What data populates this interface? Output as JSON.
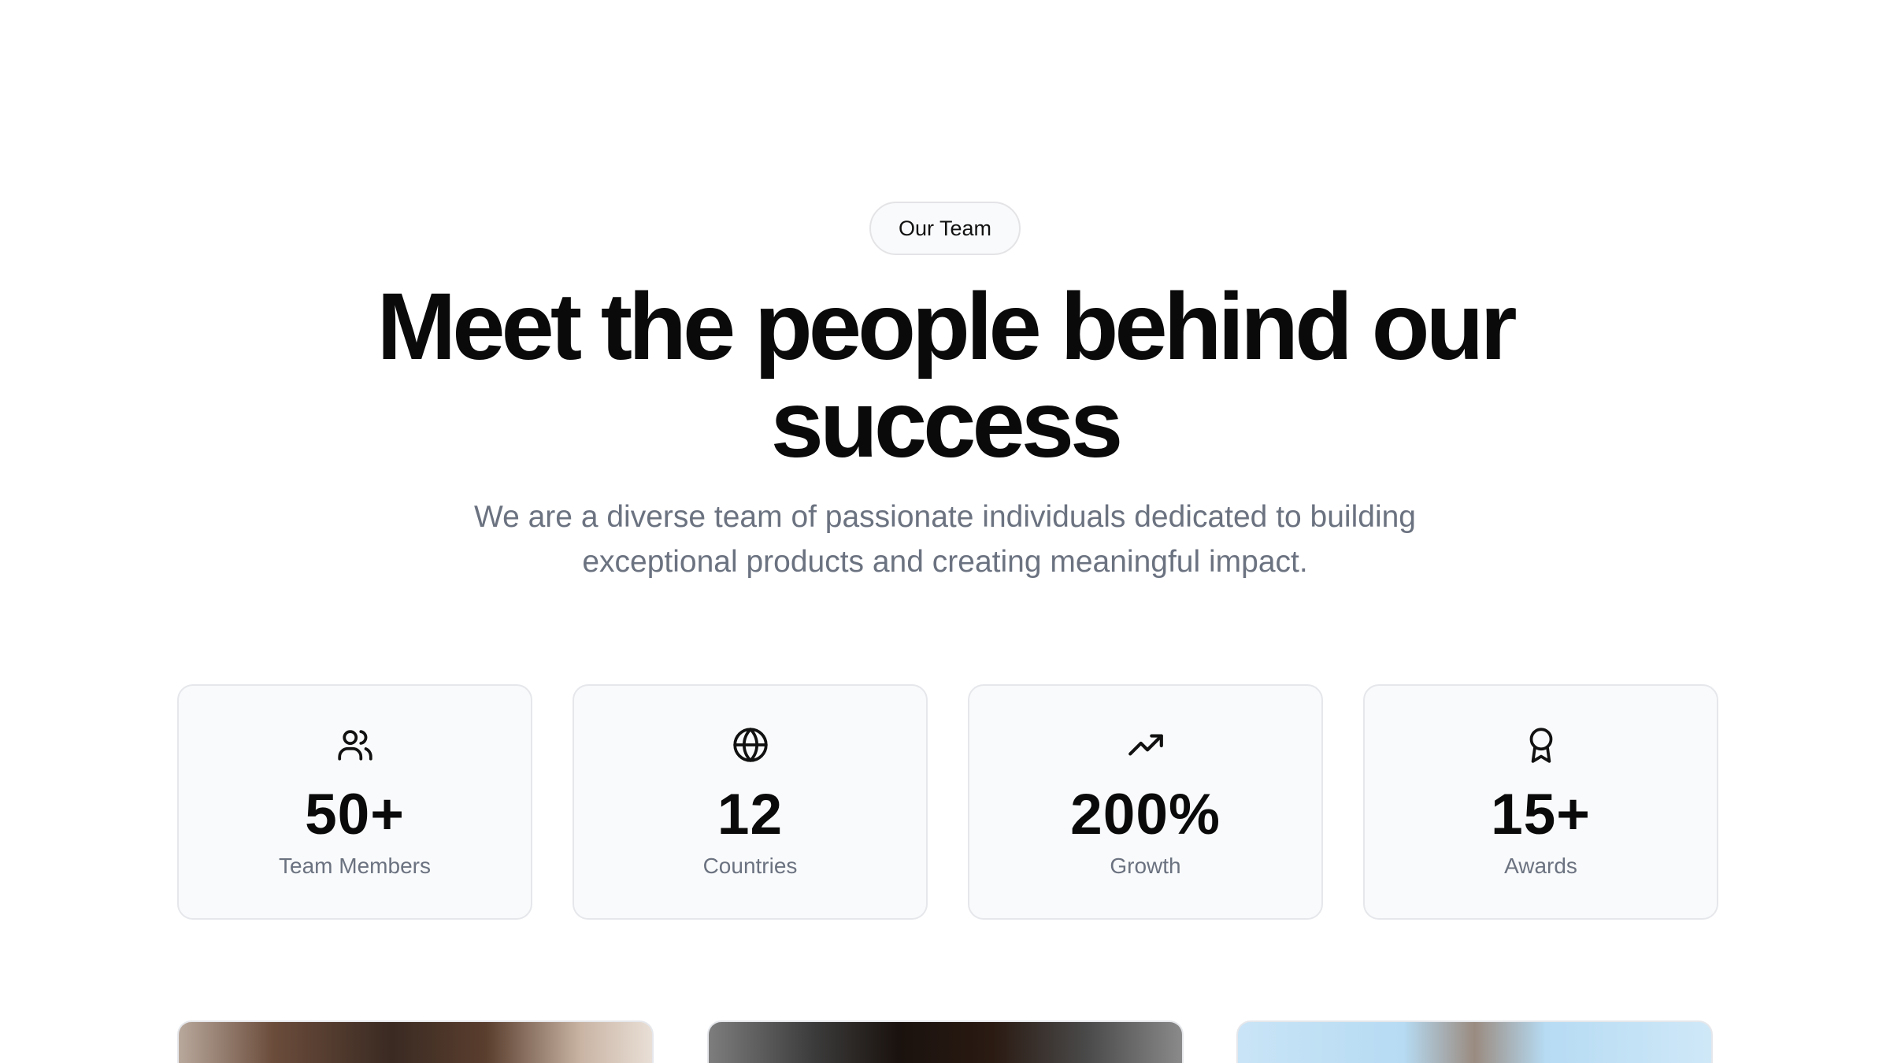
{
  "badge": {
    "label": "Our Team"
  },
  "hero": {
    "title_line1": "Meet the people behind our",
    "title_line2": "success",
    "subtitle_line1": "We are a diverse team of passionate individuals dedicated to building",
    "subtitle_line2": "exceptional products and creating meaningful impact."
  },
  "stats": [
    {
      "icon": "users-icon",
      "value": "50+",
      "label": "Team Members"
    },
    {
      "icon": "globe-icon",
      "value": "12",
      "label": "Countries"
    },
    {
      "icon": "trending-up-icon",
      "value": "200%",
      "label": "Growth"
    },
    {
      "icon": "award-icon",
      "value": "15+",
      "label": "Awards"
    }
  ],
  "team_photos": [
    {
      "icon": "team-member-photo"
    },
    {
      "icon": "team-member-photo"
    },
    {
      "icon": "team-member-photo"
    }
  ]
}
